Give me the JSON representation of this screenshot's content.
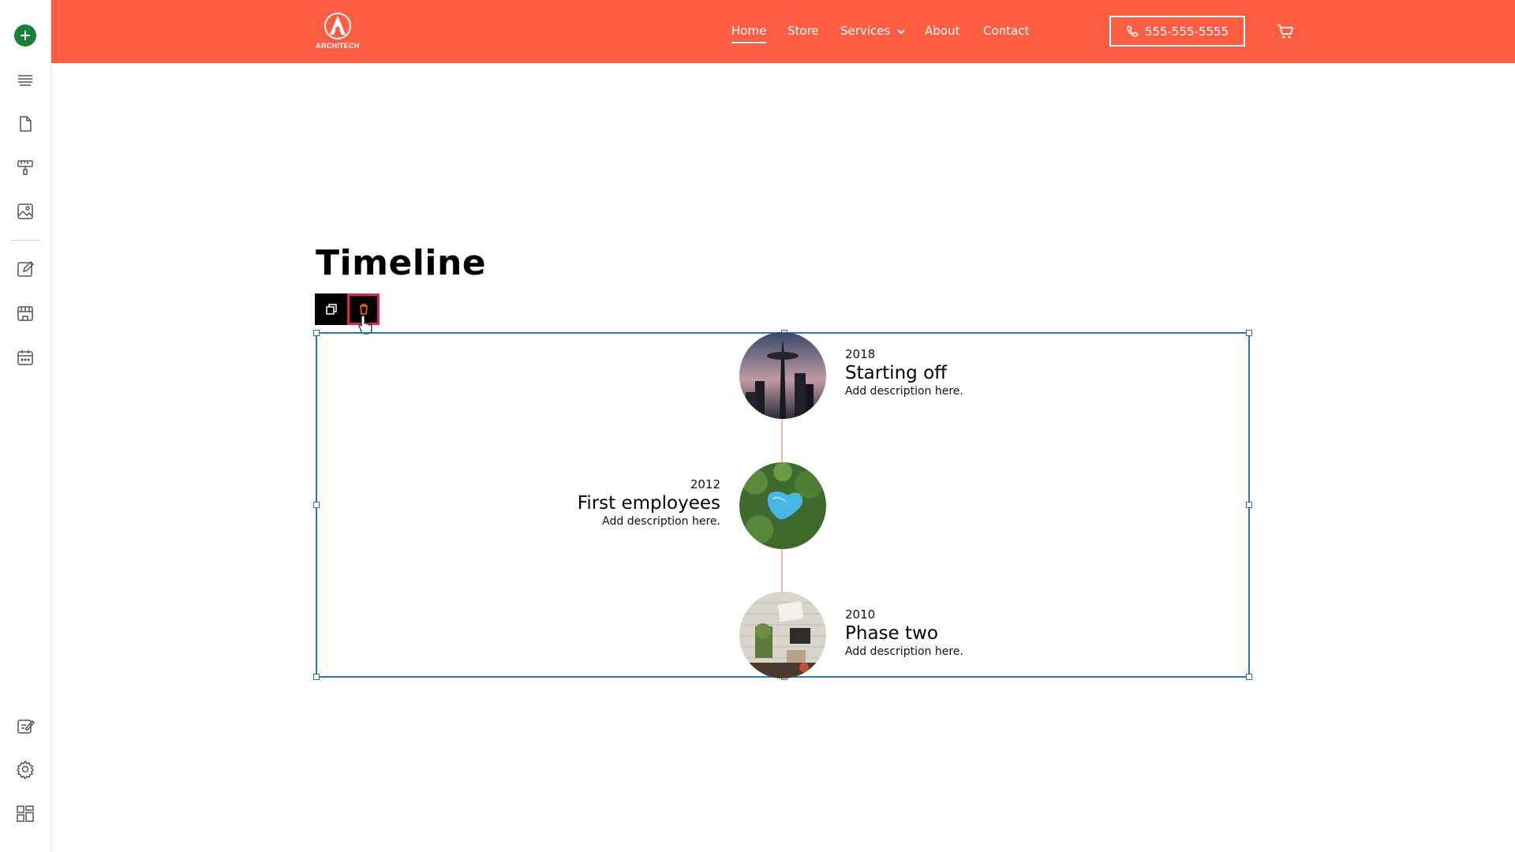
{
  "sidebar": {
    "items": [
      {
        "name": "add-icon"
      },
      {
        "name": "layers-icon"
      },
      {
        "name": "page-icon"
      },
      {
        "name": "theme-paint-icon"
      },
      {
        "name": "image-icon"
      },
      {
        "name": "edit-icon"
      },
      {
        "name": "store-icon"
      },
      {
        "name": "calendar-icon"
      },
      {
        "name": "site-edit-icon"
      },
      {
        "name": "settings-icon"
      },
      {
        "name": "layout-icon"
      }
    ]
  },
  "header": {
    "logo_text": "ARCHITECH",
    "nav": [
      {
        "label": "Home",
        "active": true
      },
      {
        "label": "Store",
        "active": false
      },
      {
        "label": "Services",
        "active": false
      },
      {
        "label": "About",
        "active": false
      },
      {
        "label": "Contact",
        "active": false
      }
    ],
    "phone": "555-555-5555",
    "brand_color": "#ff5e45"
  },
  "main": {
    "title": "Timeline",
    "toolbar": {
      "duplicate_icon": "duplicate-icon",
      "delete_icon": "trash-icon"
    },
    "timeline": [
      {
        "year": "2018",
        "title": "Starting off",
        "description": "Add description here.",
        "side": "right",
        "image": "space-needle-photo"
      },
      {
        "year": "2012",
        "title": "First employees",
        "description": "Add description here.",
        "side": "left",
        "image": "pool-aerial-photo"
      },
      {
        "year": "2010",
        "title": "Phase two",
        "description": "Add description here.",
        "side": "right",
        "image": "desk-flatlay-photo"
      }
    ]
  }
}
